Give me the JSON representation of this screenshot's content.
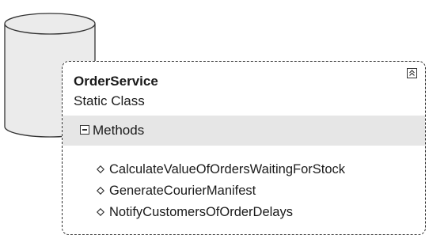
{
  "class_shape": {
    "name": "OrderService",
    "stereotype": "Static Class",
    "collapse_icon": "double-chevron-up-icon",
    "sections": [
      {
        "label": "Methods",
        "toggle_icon": "minus-box-icon",
        "member_icon": "diamond-outline-icon",
        "members": [
          {
            "label": "CalculateValueOfOrdersWaitingForStock"
          },
          {
            "label": "GenerateCourierManifest"
          },
          {
            "label": "NotifyCustomersOfOrderDelays"
          }
        ]
      }
    ]
  },
  "background_shape": {
    "kind": "database-cylinder"
  },
  "colors": {
    "border": "#333333",
    "section_header_bg": "#e6e6e6",
    "cylinder_fill": "#ebebeb",
    "text": "#1a1a1a"
  }
}
